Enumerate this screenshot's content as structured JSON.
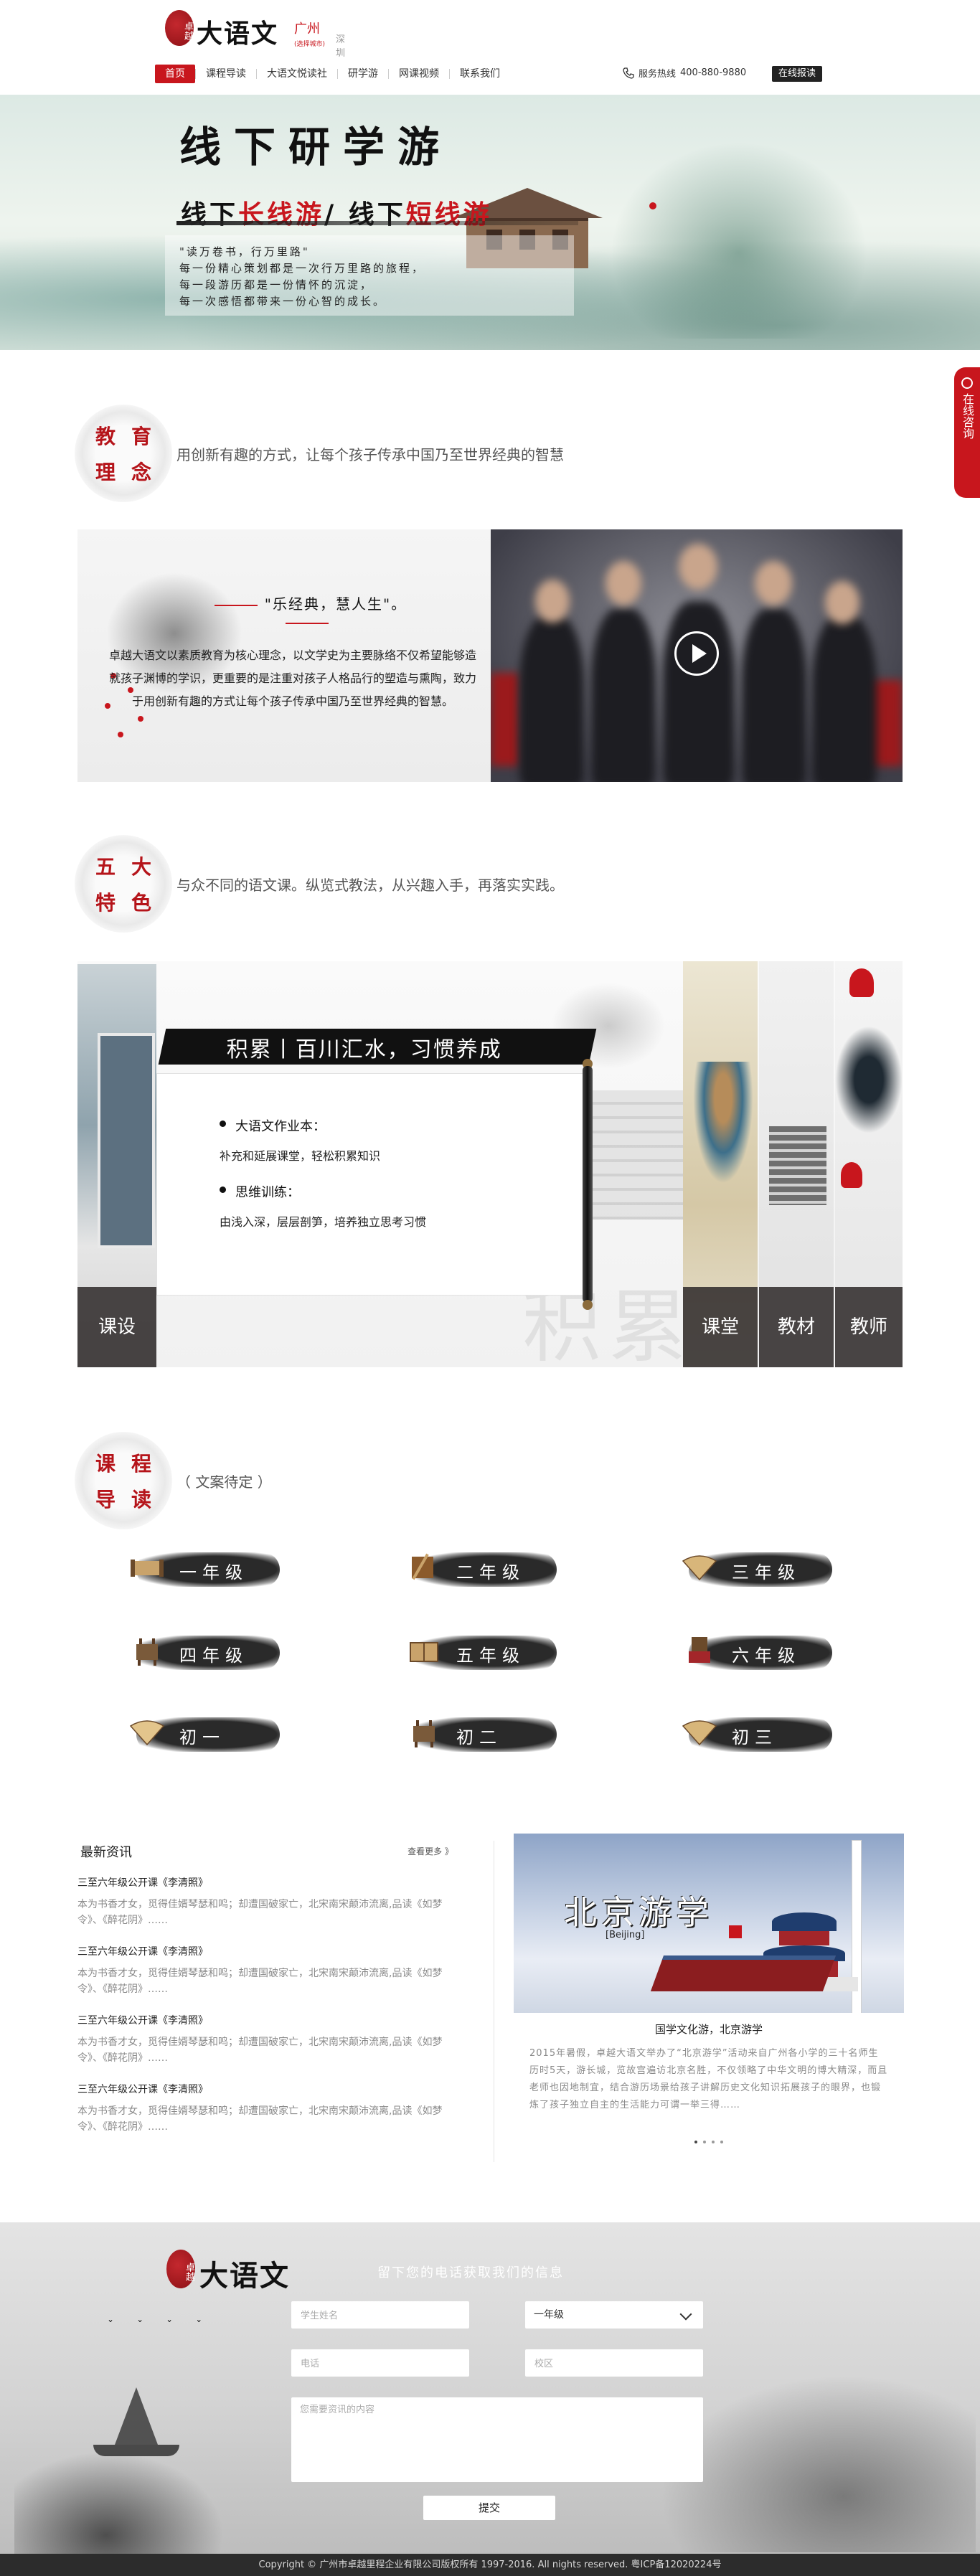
{
  "header": {
    "logo_seal": "卓越",
    "logo_name": "大语文",
    "city_current": "广州",
    "city_sub": "(选择城市)",
    "city_other": "深圳",
    "nav": [
      {
        "label": "首页"
      },
      {
        "label": "课程导读"
      },
      {
        "label": "大语文悦读社"
      },
      {
        "label": "研学游"
      },
      {
        "label": "网课视频"
      },
      {
        "label": "联系我们"
      }
    ],
    "hotline_label": "服务热线",
    "hotline_number": "400-880-9880",
    "enroll_label": "在线报读"
  },
  "banner": {
    "title": "线下研学游",
    "subtitle_prefix": "线下",
    "subtitle_long": "长线游",
    "subtitle_sep": "/ 线下",
    "subtitle_short": "短线游",
    "poem": [
      "\"读万卷书，行万里路\"",
      "每一份精心策划都是一次行万里路的旅程，",
      "每一段游历都是一份情怀的沉淀，",
      "每一次感悟都带来一份心智的成长。"
    ]
  },
  "consult": {
    "label": "在线咨询"
  },
  "philosophy": {
    "badge": [
      "教",
      "育",
      "理",
      "念"
    ],
    "intro": "用创新有趣的方式，让每个孩子传承中国乃至世界经典的智慧",
    "motto": "\"乐经典，慧人生\"。",
    "paragraph": "卓越大语文以素质教育为核心理念，以文学史为主要脉络不仅希望能够造就孩子渊博的学识，更重要的是注重对孩子人格品行的塑造与熏陶，致力于用创新有趣的方式让每个孩子传承中国乃至世界经典的智慧。"
  },
  "features": {
    "badge": [
      "五",
      "大",
      "特",
      "色"
    ],
    "intro": "与众不同的语文课。纵览式教法，从兴趣入手，再落实实践。",
    "banner_title": "积累丨百川汇水，习惯养成",
    "items": [
      {
        "heading": "大语文作业本：",
        "desc": "补充和延展课堂，轻松积累知识"
      },
      {
        "heading": "思维训练：",
        "desc": "由浅入深，层层剖笋，培养独立思考习惯"
      }
    ],
    "watermark": "积累",
    "tabs": [
      "课设",
      "课堂",
      "教材",
      "教师"
    ]
  },
  "courses": {
    "badge": [
      "课",
      "程",
      "导",
      "读"
    ],
    "intro": "（ 文案待定 ）",
    "grades": [
      {
        "label": "一年级",
        "icon": "scroll-icon"
      },
      {
        "label": "二年级",
        "icon": "ink-brush-icon"
      },
      {
        "label": "三年级",
        "icon": "folding-fan-icon"
      },
      {
        "label": "四年级",
        "icon": "bronze-vessel-icon"
      },
      {
        "label": "五年级",
        "icon": "book-icon"
      },
      {
        "label": "六年级",
        "icon": "chinese-seal-icon"
      },
      {
        "label": "初一",
        "icon": "folding-fan-icon"
      },
      {
        "label": "初二",
        "icon": "bronze-vessel-icon"
      },
      {
        "label": "初三",
        "icon": "folding-fan-icon"
      }
    ]
  },
  "news": {
    "title": "最新资讯",
    "more": "查看更多 》",
    "items": [
      {
        "title": "三至六年级公开课《李清照》",
        "desc": "本为书香才女，觅得佳婿琴瑟和鸣；却遭国破家亡，北宋南宋颠沛流离,品读《如梦令》、《醉花阴》……"
      },
      {
        "title": "三至六年级公开课《李清照》",
        "desc": "本为书香才女，觅得佳婿琴瑟和鸣；却遭国破家亡，北宋南宋颠沛流离,品读《如梦令》、《醉花阴》……"
      },
      {
        "title": "三至六年级公开课《李清照》",
        "desc": "本为书香才女，觅得佳婿琴瑟和鸣；却遭国破家亡，北宋南宋颠沛流离,品读《如梦令》、《醉花阴》……"
      },
      {
        "title": "三至六年级公开课《李清照》",
        "desc": "本为书香才女，觅得佳婿琴瑟和鸣；却遭国破家亡，北宋南宋颠沛流离,品读《如梦令》、《醉花阴》……"
      }
    ],
    "feature": {
      "image_title": "北京游学",
      "image_sub": "[Beijing]",
      "caption": "国学文化游，北京游学",
      "desc": "2015年暑假，卓越大语文举办了“北京游学”活动来自广州各小学的三十名师生历时5天，游长城，览故宫遍访北京名胜，不仅领略了中华文明的博大精深，而且老师也因地制宜，结合游历场景给孩子讲解历史文化知识拓展孩子的眼界，也锻炼了孩子独立自主的生活能力可谓一举三得……"
    }
  },
  "form": {
    "logo_seal": "卓越",
    "logo_name": "大语文",
    "slogan": "留下您的电话获取我们的信息",
    "name_placeholder": "学生姓名",
    "grade_value": "一年级",
    "phone_placeholder": "电话",
    "campus_placeholder": "校区",
    "message_placeholder": "您需要资讯的内容",
    "submit_label": "提交"
  },
  "copyright": "Copyright © 广州市卓越里程企业有限公司版权所有 1997-2016. All nights reserved. 粤ICP备12020224号",
  "colors": {
    "accent": "#c8161d",
    "dark": "#2c2c2c"
  }
}
